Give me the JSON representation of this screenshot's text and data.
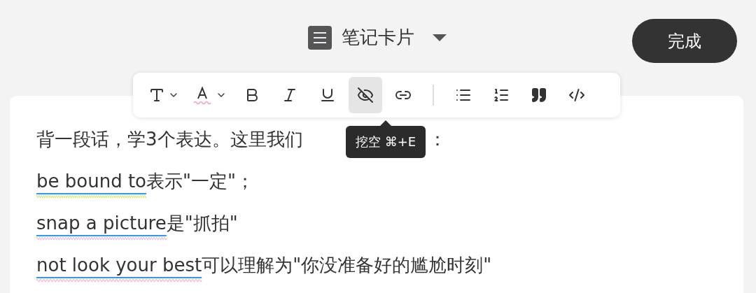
{
  "header": {
    "title": "笔记卡片",
    "done_button": "完成"
  },
  "toolbar": [
    {
      "kind": "text-style",
      "selected": false
    },
    {
      "kind": "font-color",
      "selected": false
    },
    {
      "kind": "bold",
      "selected": false
    },
    {
      "kind": "italic",
      "selected": false
    },
    {
      "kind": "underline",
      "selected": false
    },
    {
      "kind": "hide",
      "selected": true
    },
    {
      "kind": "link",
      "selected": false
    },
    {
      "kind": "divider"
    },
    {
      "kind": "bullet-list",
      "selected": false
    },
    {
      "kind": "numbered-list",
      "selected": false
    },
    {
      "kind": "quote",
      "selected": false
    },
    {
      "kind": "code",
      "selected": false
    }
  ],
  "tooltip": "挖空 ⌘+E",
  "intro": {
    "before": "背一段话，学3个表达。这里我们",
    "after": "："
  },
  "expressions": [
    {
      "term": "be bound to",
      "rest": "表示\"一定\"；",
      "color": "#c9e46e"
    },
    {
      "term": "snap a picture",
      "rest": "是\"抓拍\"",
      "color": "#f4b3cf"
    },
    {
      "term": "not look your best",
      "rest": "可以理解为\"你没准备好的尴尬时刻\"",
      "color": "#f4b3cf"
    }
  ]
}
